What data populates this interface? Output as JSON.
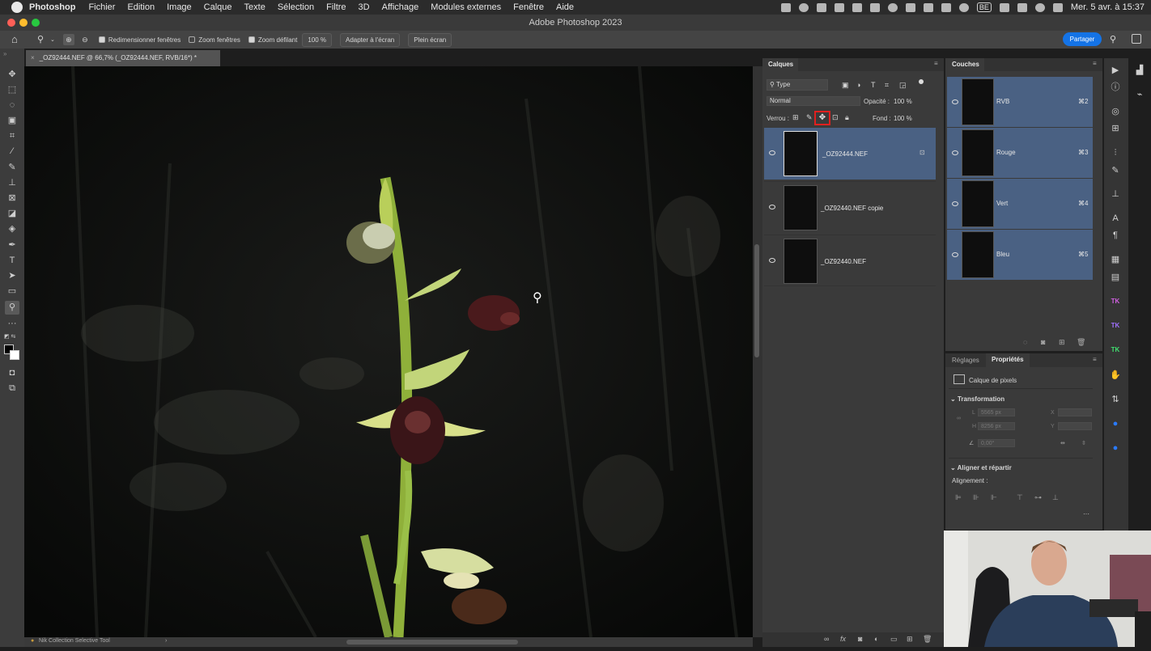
{
  "menu": {
    "app": "Photoshop",
    "items": [
      "Fichier",
      "Edition",
      "Image",
      "Calque",
      "Texte",
      "Sélection",
      "Filtre",
      "3D",
      "Affichage",
      "Modules externes",
      "Fenêtre",
      "Aide"
    ],
    "status": {
      "keyboard": "BE",
      "clock": "Mer. 5 avr. à 15:37"
    }
  },
  "window": {
    "title": "Adobe Photoshop 2023"
  },
  "options": {
    "zoom_value": "100 %",
    "resize_windows": "Redimensionner fenêtres",
    "zoom_all_windows": "Zoom fenêtres",
    "scrubby_zoom": "Zoom défilant",
    "fit_screen": "Adapter à l'écran",
    "fill_screen": "Plein écran",
    "share": "Partager"
  },
  "document": {
    "tab_title": "_OZ92444.NEF @ 66,7% (_OZ92444.NEF, RVB/16*) *"
  },
  "layers_panel": {
    "title": "Calques",
    "filter": "Type",
    "blend_mode": "Normal",
    "opacity_label": "Opacité :",
    "opacity_value": "100 %",
    "lock_label": "Verrou :",
    "fill_label": "Fond :",
    "fill_value": "100 %",
    "layers": [
      {
        "name": "_OZ92444.NEF",
        "selected": true
      },
      {
        "name": "_OZ92440.NEF copie",
        "selected": false
      },
      {
        "name": "_OZ92440.NEF",
        "selected": false
      }
    ]
  },
  "channels_panel": {
    "title": "Couches",
    "channels": [
      {
        "name": "RVB",
        "shortcut": "⌘2"
      },
      {
        "name": "Rouge",
        "shortcut": "⌘3"
      },
      {
        "name": "Vert",
        "shortcut": "⌘4"
      },
      {
        "name": "Bleu",
        "shortcut": "⌘5"
      }
    ]
  },
  "properties_panel": {
    "tab_adjustments": "Réglages",
    "tab_properties": "Propriétés",
    "type": "Calque de pixels",
    "transform": "Transformation",
    "width_label": "L",
    "width_value": "5565 px",
    "height_label": "H",
    "height_value": "8256 px",
    "x_label": "X",
    "y_label": "Y",
    "angle_value": "0,00°",
    "align_section": "Aligner et répartir",
    "alignment_label": "Alignement :"
  },
  "status_bar": {
    "plugin": "Nik Collection Selective Tool"
  },
  "colors": {
    "accent": "#1473e6",
    "selection": "#4a6183",
    "highlight": "#e0201f"
  }
}
